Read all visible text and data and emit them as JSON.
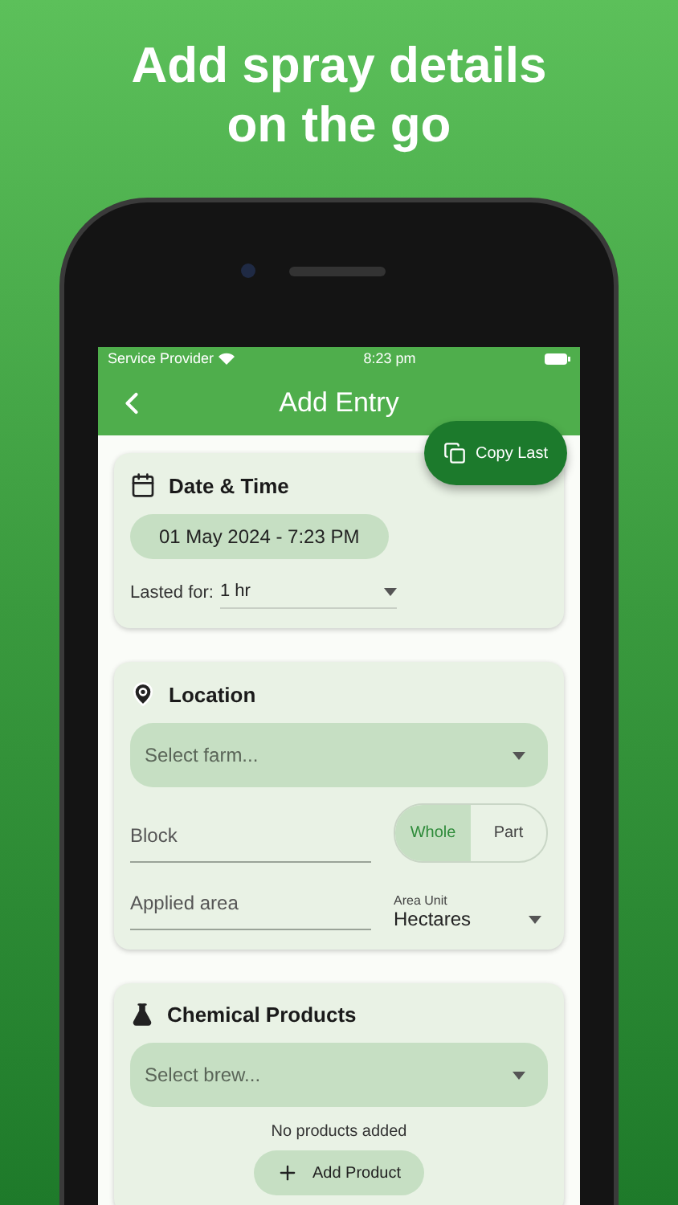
{
  "headline": "Add spray details on the go",
  "status_bar": {
    "carrier": "Service Provider",
    "time": "8:23 pm"
  },
  "app_bar": {
    "title": "Add Entry"
  },
  "copy_button": {
    "label": "Copy Last"
  },
  "date_time": {
    "title": "Date & Time",
    "date": "01 May 2024 - 7:23 PM",
    "lasted_label": "Lasted for:",
    "lasted_value": "1  hr"
  },
  "location": {
    "title": "Location",
    "farm_placeholder": "Select farm...",
    "block_placeholder": "Block",
    "toggle": [
      {
        "label": "Whole",
        "selected": true
      },
      {
        "label": "Part",
        "selected": false
      }
    ],
    "area_placeholder": "Applied area",
    "unit_label": "Area Unit",
    "unit_value": "Hectares"
  },
  "chemical_products": {
    "title": "Chemical Products",
    "brew_placeholder": "Select brew...",
    "empty_text": "No products added",
    "add_label": "Add Product"
  }
}
